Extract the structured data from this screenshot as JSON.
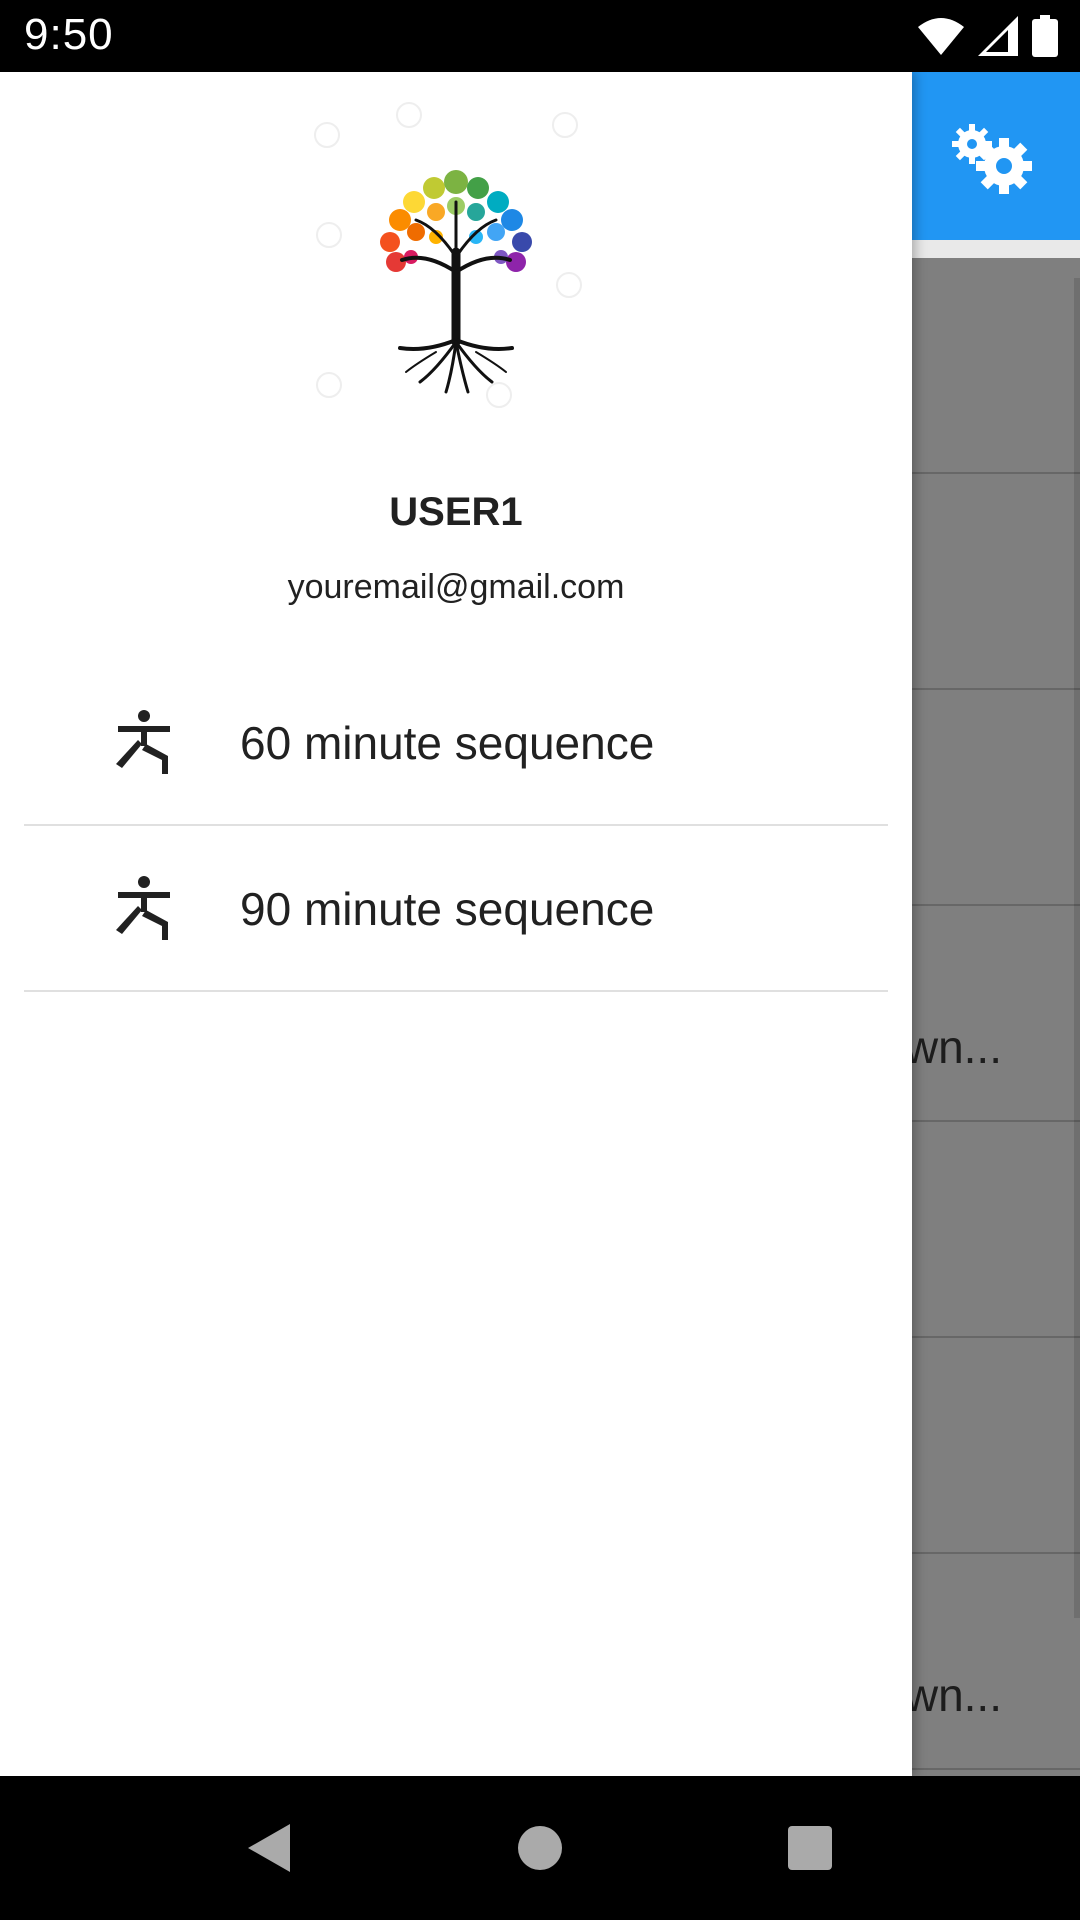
{
  "status_bar": {
    "time": "9:50",
    "icons": [
      "wifi-icon",
      "signal-icon",
      "battery-icon"
    ]
  },
  "app": {
    "accent_color": "#2196f3",
    "settings_icon": "gears-icon",
    "list_rows": [
      {
        "text": ""
      },
      {
        "text": ""
      },
      {
        "text": ""
      },
      {
        "text": "wn..."
      },
      {
        "text": ""
      },
      {
        "text": ""
      },
      {
        "text": "wn..."
      }
    ]
  },
  "drawer": {
    "logo": "tree-of-life-logo",
    "user_name": "USER1",
    "user_email": "youremail@gmail.com",
    "items": [
      {
        "label": "60 minute sequence",
        "icon": "yoga-pose-icon"
      },
      {
        "label": "90 minute sequence",
        "icon": "yoga-pose-icon"
      }
    ]
  },
  "nav_bar": {
    "buttons": [
      "back-icon",
      "home-icon",
      "recents-icon"
    ]
  }
}
